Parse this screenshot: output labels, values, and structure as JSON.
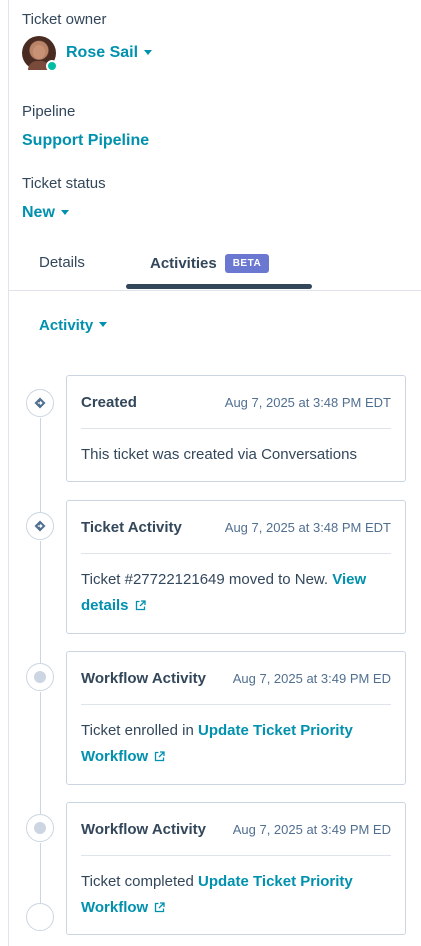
{
  "ticket_owner": {
    "label": "Ticket owner",
    "name": "Rose Sail"
  },
  "pipeline": {
    "label": "Pipeline",
    "value": "Support Pipeline"
  },
  "ticket_status": {
    "label": "Ticket status",
    "value": "New"
  },
  "tabs": [
    {
      "label": "Details"
    },
    {
      "label": "Activities",
      "badge": "BETA"
    }
  ],
  "filter": {
    "label": "Activity"
  },
  "activities": [
    {
      "title": "Created",
      "timestamp": "Aug 7, 2025 at 3:48 PM EDT",
      "body_text": "This ticket was created via Conversations",
      "link_text": "",
      "icon": "diamond-arrow-icon"
    },
    {
      "title": "Ticket Activity",
      "timestamp": "Aug 7, 2025 at 3:48 PM EDT",
      "body_text": "Ticket #27722121649 moved to New.",
      "link_text": "View details",
      "icon": "diamond-arrow-icon"
    },
    {
      "title": "Workflow Activity",
      "timestamp": "Aug 7, 2025 at 3:49 PM ED",
      "body_text": "Ticket enrolled in",
      "link_text": "Update Ticket Priority Workflow",
      "icon": "dot-icon"
    },
    {
      "title": "Workflow Activity",
      "timestamp": "Aug 7, 2025 at 3:49 PM ED",
      "body_text": "Ticket completed",
      "link_text": "Update Ticket Priority Workflow",
      "icon": "dot-icon"
    }
  ],
  "colors": {
    "link": "#0091ae",
    "text": "#33475b",
    "beta_badge": "#6a78d1",
    "status_online": "#00bda5",
    "border": "#cbd6e2"
  }
}
